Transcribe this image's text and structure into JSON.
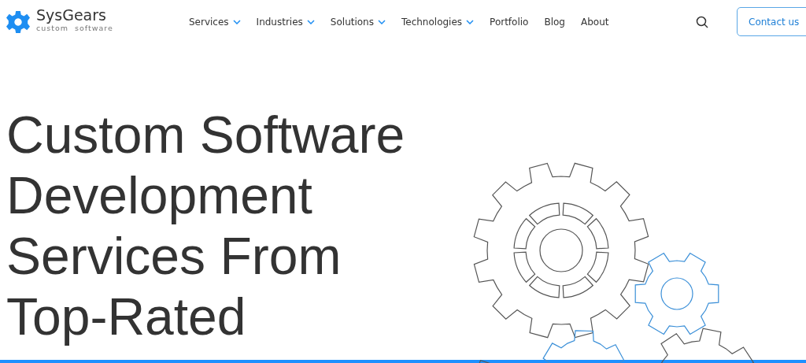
{
  "logo": {
    "name": "SysGears",
    "tagline": "custom  software"
  },
  "nav": [
    {
      "label": "Services",
      "dropdown": true
    },
    {
      "label": "Industries",
      "dropdown": true
    },
    {
      "label": "Solutions",
      "dropdown": true
    },
    {
      "label": "Technologies",
      "dropdown": true
    },
    {
      "label": "Portfolio",
      "dropdown": false
    },
    {
      "label": "Blog",
      "dropdown": false
    },
    {
      "label": "About",
      "dropdown": false
    }
  ],
  "contact_button": "Contact us",
  "hero": {
    "heading_lines": [
      "Custom Software",
      "Development",
      "Services From",
      "Top-Rated"
    ]
  }
}
